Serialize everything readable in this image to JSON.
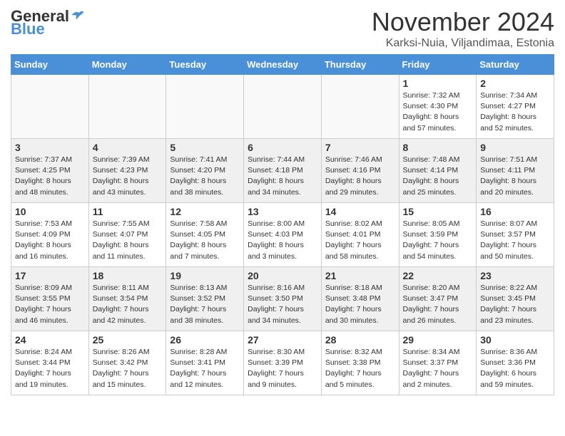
{
  "logo": {
    "general": "General",
    "blue": "Blue"
  },
  "title": "November 2024",
  "location": "Karksi-Nuia, Viljandimaa, Estonia",
  "days_of_week": [
    "Sunday",
    "Monday",
    "Tuesday",
    "Wednesday",
    "Thursday",
    "Friday",
    "Saturday"
  ],
  "weeks": [
    [
      {
        "num": "",
        "info": ""
      },
      {
        "num": "",
        "info": ""
      },
      {
        "num": "",
        "info": ""
      },
      {
        "num": "",
        "info": ""
      },
      {
        "num": "",
        "info": ""
      },
      {
        "num": "1",
        "info": "Sunrise: 7:32 AM\nSunset: 4:30 PM\nDaylight: 8 hours and 57 minutes."
      },
      {
        "num": "2",
        "info": "Sunrise: 7:34 AM\nSunset: 4:27 PM\nDaylight: 8 hours and 52 minutes."
      }
    ],
    [
      {
        "num": "3",
        "info": "Sunrise: 7:37 AM\nSunset: 4:25 PM\nDaylight: 8 hours and 48 minutes."
      },
      {
        "num": "4",
        "info": "Sunrise: 7:39 AM\nSunset: 4:23 PM\nDaylight: 8 hours and 43 minutes."
      },
      {
        "num": "5",
        "info": "Sunrise: 7:41 AM\nSunset: 4:20 PM\nDaylight: 8 hours and 38 minutes."
      },
      {
        "num": "6",
        "info": "Sunrise: 7:44 AM\nSunset: 4:18 PM\nDaylight: 8 hours and 34 minutes."
      },
      {
        "num": "7",
        "info": "Sunrise: 7:46 AM\nSunset: 4:16 PM\nDaylight: 8 hours and 29 minutes."
      },
      {
        "num": "8",
        "info": "Sunrise: 7:48 AM\nSunset: 4:14 PM\nDaylight: 8 hours and 25 minutes."
      },
      {
        "num": "9",
        "info": "Sunrise: 7:51 AM\nSunset: 4:11 PM\nDaylight: 8 hours and 20 minutes."
      }
    ],
    [
      {
        "num": "10",
        "info": "Sunrise: 7:53 AM\nSunset: 4:09 PM\nDaylight: 8 hours and 16 minutes."
      },
      {
        "num": "11",
        "info": "Sunrise: 7:55 AM\nSunset: 4:07 PM\nDaylight: 8 hours and 11 minutes."
      },
      {
        "num": "12",
        "info": "Sunrise: 7:58 AM\nSunset: 4:05 PM\nDaylight: 8 hours and 7 minutes."
      },
      {
        "num": "13",
        "info": "Sunrise: 8:00 AM\nSunset: 4:03 PM\nDaylight: 8 hours and 3 minutes."
      },
      {
        "num": "14",
        "info": "Sunrise: 8:02 AM\nSunset: 4:01 PM\nDaylight: 7 hours and 58 minutes."
      },
      {
        "num": "15",
        "info": "Sunrise: 8:05 AM\nSunset: 3:59 PM\nDaylight: 7 hours and 54 minutes."
      },
      {
        "num": "16",
        "info": "Sunrise: 8:07 AM\nSunset: 3:57 PM\nDaylight: 7 hours and 50 minutes."
      }
    ],
    [
      {
        "num": "17",
        "info": "Sunrise: 8:09 AM\nSunset: 3:55 PM\nDaylight: 7 hours and 46 minutes."
      },
      {
        "num": "18",
        "info": "Sunrise: 8:11 AM\nSunset: 3:54 PM\nDaylight: 7 hours and 42 minutes."
      },
      {
        "num": "19",
        "info": "Sunrise: 8:13 AM\nSunset: 3:52 PM\nDaylight: 7 hours and 38 minutes."
      },
      {
        "num": "20",
        "info": "Sunrise: 8:16 AM\nSunset: 3:50 PM\nDaylight: 7 hours and 34 minutes."
      },
      {
        "num": "21",
        "info": "Sunrise: 8:18 AM\nSunset: 3:48 PM\nDaylight: 7 hours and 30 minutes."
      },
      {
        "num": "22",
        "info": "Sunrise: 8:20 AM\nSunset: 3:47 PM\nDaylight: 7 hours and 26 minutes."
      },
      {
        "num": "23",
        "info": "Sunrise: 8:22 AM\nSunset: 3:45 PM\nDaylight: 7 hours and 23 minutes."
      }
    ],
    [
      {
        "num": "24",
        "info": "Sunrise: 8:24 AM\nSunset: 3:44 PM\nDaylight: 7 hours and 19 minutes."
      },
      {
        "num": "25",
        "info": "Sunrise: 8:26 AM\nSunset: 3:42 PM\nDaylight: 7 hours and 15 minutes."
      },
      {
        "num": "26",
        "info": "Sunrise: 8:28 AM\nSunset: 3:41 PM\nDaylight: 7 hours and 12 minutes."
      },
      {
        "num": "27",
        "info": "Sunrise: 8:30 AM\nSunset: 3:39 PM\nDaylight: 7 hours and 9 minutes."
      },
      {
        "num": "28",
        "info": "Sunrise: 8:32 AM\nSunset: 3:38 PM\nDaylight: 7 hours and 5 minutes."
      },
      {
        "num": "29",
        "info": "Sunrise: 8:34 AM\nSunset: 3:37 PM\nDaylight: 7 hours and 2 minutes."
      },
      {
        "num": "30",
        "info": "Sunrise: 8:36 AM\nSunset: 3:36 PM\nDaylight: 6 hours and 59 minutes."
      }
    ]
  ]
}
